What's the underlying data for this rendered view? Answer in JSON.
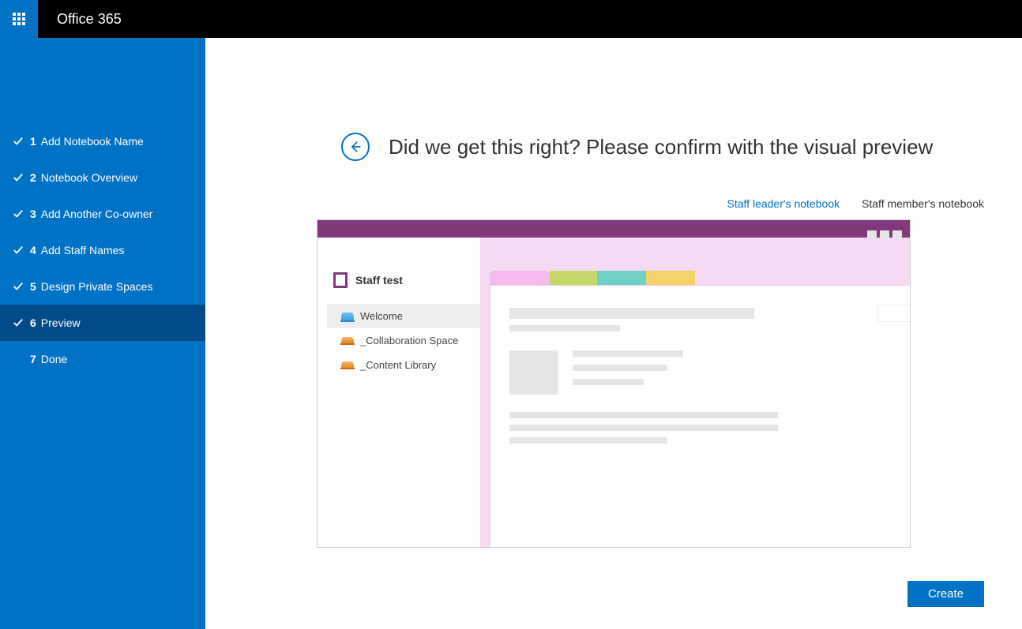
{
  "brand": "Office 365",
  "steps": [
    {
      "num": "1",
      "label": "Add Notebook Name"
    },
    {
      "num": "2",
      "label": "Notebook Overview"
    },
    {
      "num": "3",
      "label": "Add Another Co-owner"
    },
    {
      "num": "4",
      "label": "Add Staff Names"
    },
    {
      "num": "5",
      "label": "Design Private Spaces"
    },
    {
      "num": "6",
      "label": "Preview"
    },
    {
      "num": "7",
      "label": "Done"
    }
  ],
  "heading": "Did we get this right? Please confirm with the visual preview",
  "tabs": {
    "leader": "Staff leader's notebook",
    "member": "Staff member's notebook"
  },
  "notebook": {
    "title": "Staff test",
    "sections": {
      "welcome": "Welcome",
      "collab": "_Collaboration Space",
      "library": "_Content Library"
    }
  },
  "buttons": {
    "create": "Create"
  }
}
